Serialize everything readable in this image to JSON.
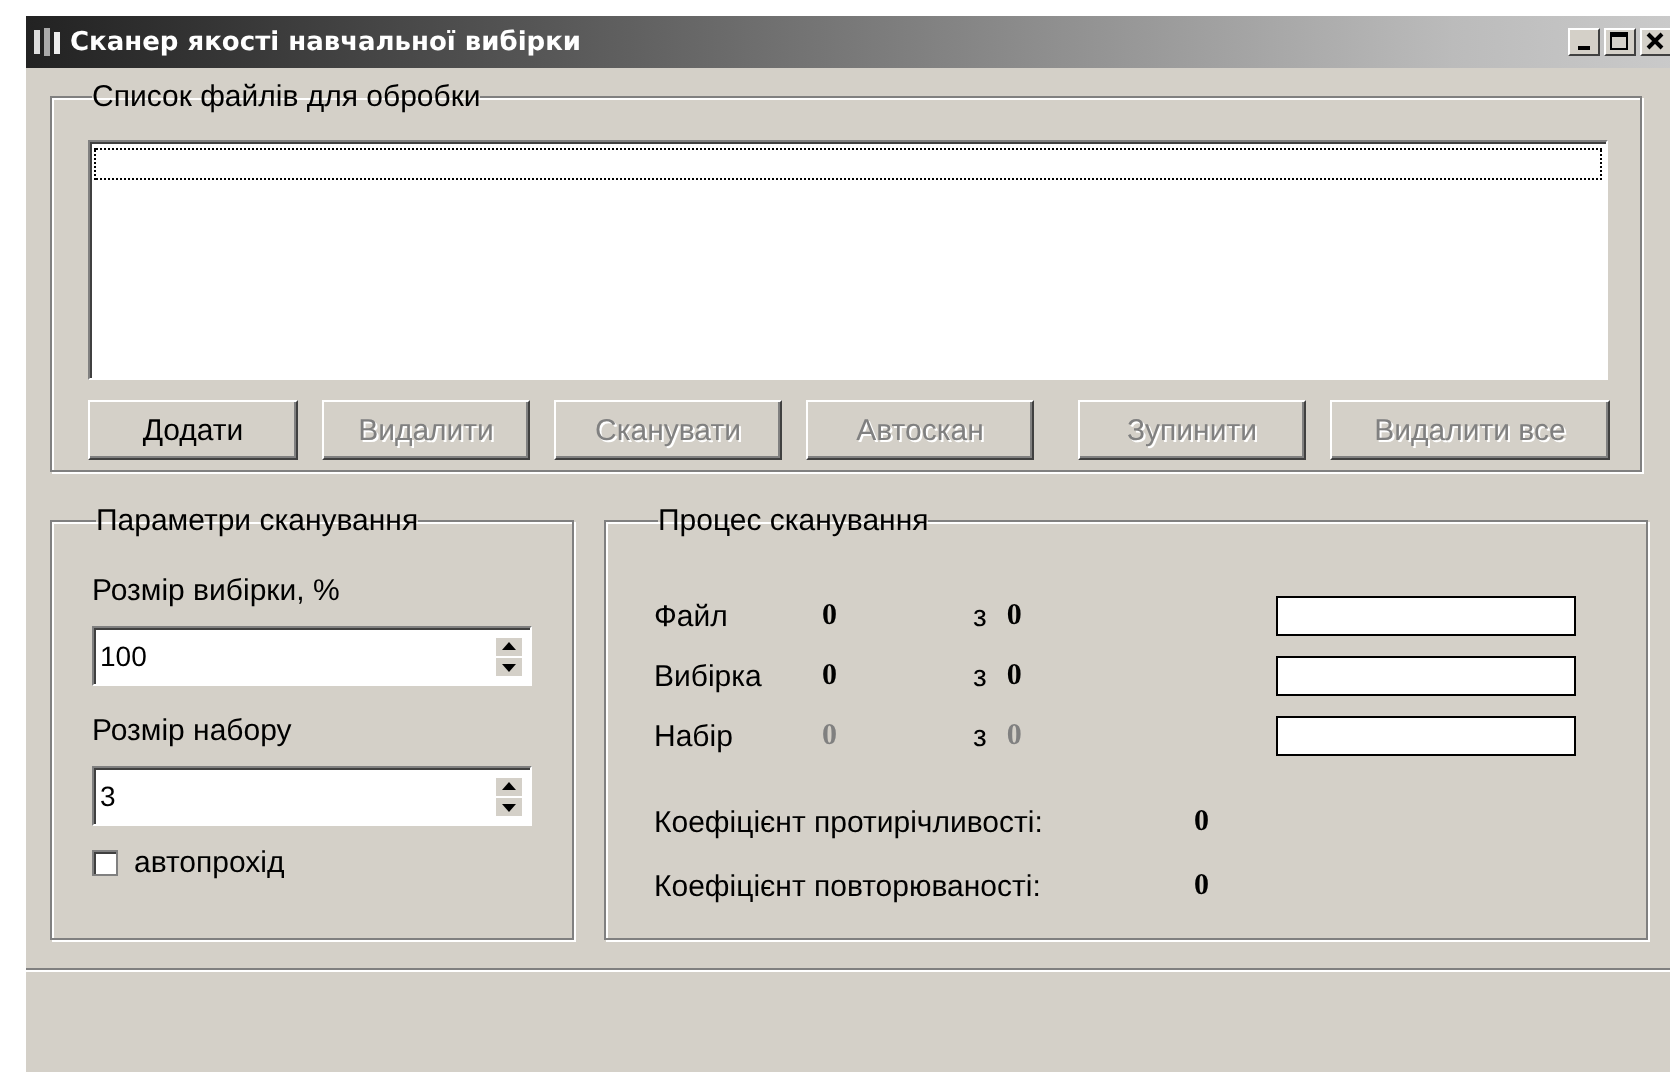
{
  "window": {
    "title": "Сканер якості навчальної вибірки"
  },
  "file_list": {
    "title": "Список файлів для обробки"
  },
  "buttons": [
    {
      "label": "Додати",
      "disabled": false
    },
    {
      "label": "Видалити",
      "disabled": true
    },
    {
      "label": "Сканувати",
      "disabled": true
    },
    {
      "label": "Автоскан",
      "disabled": true
    },
    {
      "label": "Зупинити",
      "disabled": true
    },
    {
      "label": "Видалити все",
      "disabled": true
    }
  ],
  "params": {
    "title": "Параметри сканування",
    "fields": [
      {
        "label": "Розмір вибірки, %",
        "value": "100"
      },
      {
        "label": "Розмір набору",
        "value": "3"
      }
    ],
    "autopass": {
      "label": "автопрохід",
      "checked": false
    }
  },
  "process": {
    "title": "Процес сканування",
    "rows": [
      {
        "label": "Файл",
        "current": "0",
        "of": "з",
        "total": "0",
        "disabled": false,
        "level": 0
      },
      {
        "label": "Вибірка",
        "current": "0",
        "of": "з",
        "total": "0",
        "disabled": false,
        "level": 0
      },
      {
        "label": "Набір",
        "current": "0",
        "of": "з",
        "total": "0",
        "disabled": true,
        "level": 0
      }
    ],
    "coefficients": [
      {
        "label": "Коефіцієнт протирічливості:",
        "value": "0"
      },
      {
        "label": "Коефіцієнт повторюваності:",
        "value": "0"
      }
    ]
  }
}
